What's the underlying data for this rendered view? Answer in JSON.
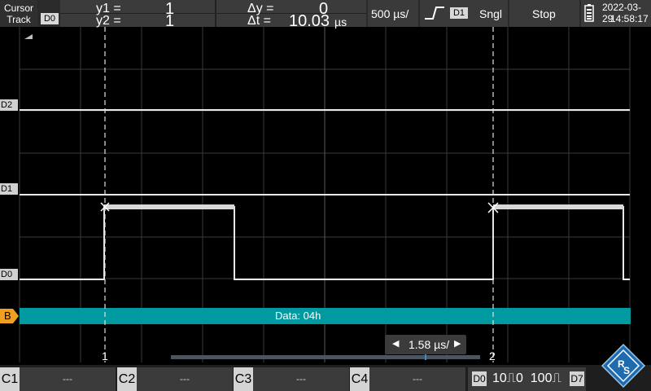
{
  "top": {
    "cursor_mode_line1": "Cursor",
    "cursor_mode_line2": "Track",
    "cursor_source": "D0",
    "y1_label": "y1 =",
    "y1_value": "1",
    "y2_label": "y2 =",
    "y2_value": "1",
    "dy_label": "Δy =",
    "dy_value": "0",
    "dt_label": "Δt =",
    "dt_value": "10.03",
    "dt_unit": "µs",
    "timebase": "500 µs/",
    "trigger_source": "D1",
    "trigger_mode": "Sngl",
    "run_state": "Stop",
    "date": "2022-03-29",
    "time": "14:58:17"
  },
  "channels": {
    "d2": "D2",
    "d1": "D1",
    "d0": "D0"
  },
  "bus": {
    "tag": "B",
    "text": "Data: 04h"
  },
  "cursors": {
    "c1_label": "1",
    "c2_label": "2"
  },
  "zoom": {
    "value": "1.58 µs/"
  },
  "bottom": {
    "c1": "C1",
    "c1_val": "---",
    "c2": "C2",
    "c2_val": "---",
    "c3": "C3",
    "c3_val": "---",
    "c4": "C4",
    "c4_val": "---",
    "logic_left": "D0",
    "logic_thresholds": "10⎍0  100⎍",
    "logic_right": "D7"
  },
  "colors": {
    "bus": "#009aa0",
    "bus_tag": "#f0a020",
    "trace": "#e8e8e8",
    "grid": "#3a3a3a",
    "brand": "#1e6bb0"
  }
}
